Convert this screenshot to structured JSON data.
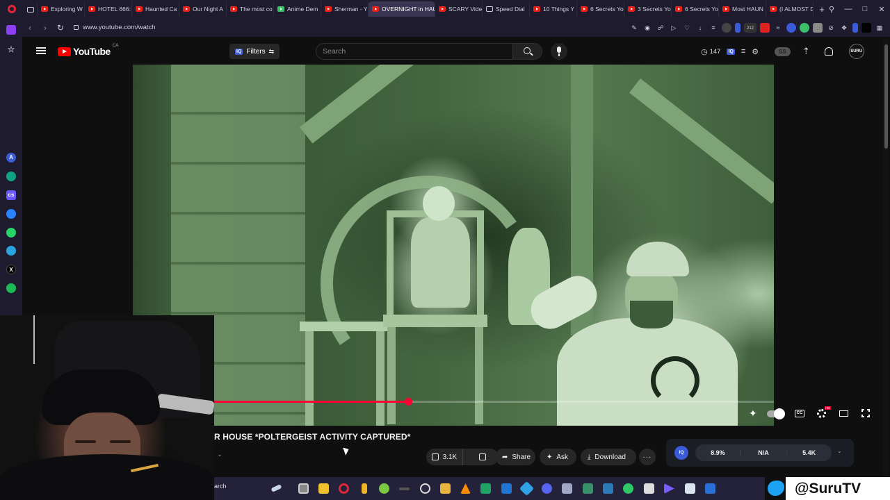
{
  "browser": {
    "tabs": [
      {
        "label": "Exploring W",
        "favicon": "youtube-icon"
      },
      {
        "label": "HOTEL 666:",
        "favicon": "youtube-icon"
      },
      {
        "label": "Haunted Ca",
        "favicon": "youtube-icon"
      },
      {
        "label": "Our Night A",
        "favicon": "youtube-icon"
      },
      {
        "label": "The most co",
        "favicon": "youtube-icon"
      },
      {
        "label": "Anime Dem",
        "favicon": "kick-icon"
      },
      {
        "label": "Sherman - Y",
        "favicon": "youtube-icon"
      },
      {
        "label": "OVERNIGHT in HAUN",
        "favicon": "youtube-icon",
        "active": true
      },
      {
        "label": "SCARY Vide",
        "favicon": "youtube-icon"
      },
      {
        "label": "Speed Dial",
        "favicon": "grid-icon"
      },
      {
        "label": "10 Things Y",
        "favicon": "youtube-icon"
      },
      {
        "label": "6 Secrets Yo",
        "favicon": "youtube-icon"
      },
      {
        "label": "3 Secrets Yo",
        "favicon": "youtube-icon"
      },
      {
        "label": "6 Secrets Yo",
        "favicon": "youtube-icon"
      },
      {
        "label": "Most HAUN",
        "favicon": "youtube-icon"
      },
      {
        "label": "(I ALMOST D",
        "favicon": "youtube-icon"
      }
    ],
    "url": "www.youtube.com/watch",
    "badge_count": "212"
  },
  "youtube": {
    "logo_text": "YouTube",
    "country": "CA",
    "filters_label": "Filters",
    "filters_badge": "IQ",
    "search_placeholder": "Search",
    "timer_count": "147",
    "account_initials": "SS",
    "avatar_text": "SURU"
  },
  "video": {
    "progress_fraction": 0.43,
    "title": "R HOUSE *POLTERGEIST ACTIVITY CAPTURED*",
    "hd_badge": "HD",
    "cc_label": "CC"
  },
  "actions": {
    "like_count": "3.1K",
    "share_label": "Share",
    "ask_label": "Ask",
    "download_label": "Download"
  },
  "iq_panel": {
    "logo": "IQ",
    "stats": [
      "8.9%",
      "N/A",
      "5.4K"
    ]
  },
  "taskbar": {
    "search_fragment": "arch"
  },
  "overlay": {
    "twitter_handle": "@SuruTV"
  },
  "colors": {
    "accent_red": "#ff0033",
    "opera_chrome": "#1f1b2e",
    "twitter_blue": "#1da1f2"
  }
}
